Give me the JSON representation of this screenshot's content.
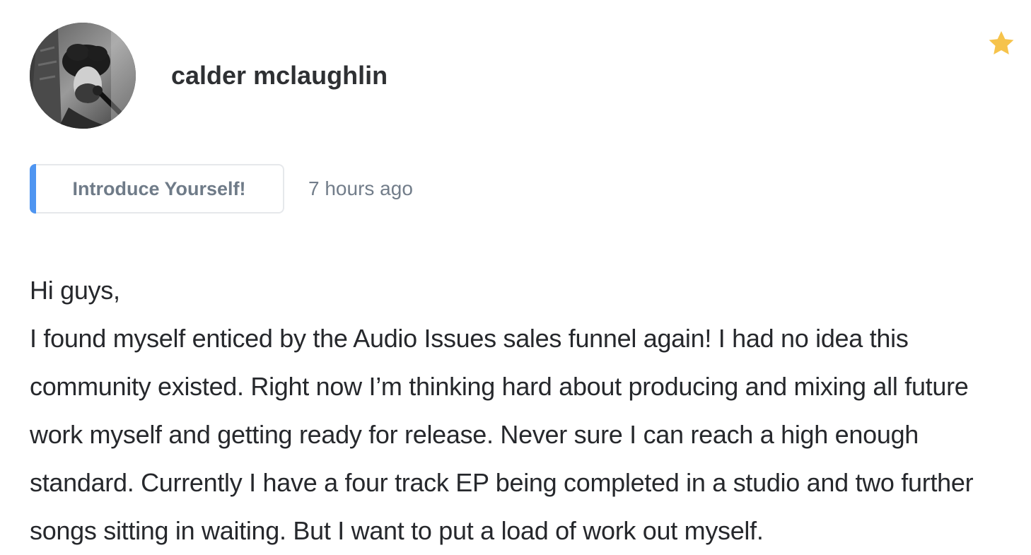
{
  "post": {
    "author": {
      "name": "calder mclaughlin",
      "avatar_icon": "user-avatar-photo"
    },
    "favorite": {
      "icon": "star-icon",
      "color": "#f6c34b",
      "active": true
    },
    "category": {
      "label": "Introduce Yourself!",
      "accent_color": "#4f95f1"
    },
    "timestamp": "7 hours ago",
    "body": {
      "greeting": "Hi guys,",
      "paragraph": "I found myself enticed by the Audio Issues sales funnel again! I had no idea this community existed. Right now I’m thinking hard about producing and mixing all future work myself and getting ready for release. Never sure I can reach a high enough standard. Currently I have a four track EP being completed in a studio and two further songs sitting in waiting. But I want to put a load of work out myself."
    }
  }
}
